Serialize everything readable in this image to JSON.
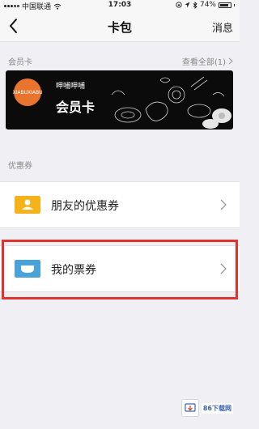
{
  "status_bar": {
    "carrier": "中国联通",
    "time": "17:03",
    "battery": "74%"
  },
  "nav": {
    "title": "卡包",
    "message_label": "消息"
  },
  "member_section": {
    "label": "会员卡",
    "view_all": "查看全部(1)"
  },
  "member_card": {
    "brand_name": "呷哺呷哺",
    "logo_text": "XIABUXIABU",
    "title": "会员卡"
  },
  "coupon_section": {
    "label": "优惠券",
    "items": [
      {
        "label": "朋友的优惠券",
        "icon": "friend-coupon-icon",
        "color": "#f5b21a"
      },
      {
        "label": "我的票券",
        "icon": "my-ticket-icon",
        "color": "#4aa3d8"
      }
    ]
  },
  "highlight_color": "#e0332e",
  "watermark": {
    "text": "86下载网"
  }
}
